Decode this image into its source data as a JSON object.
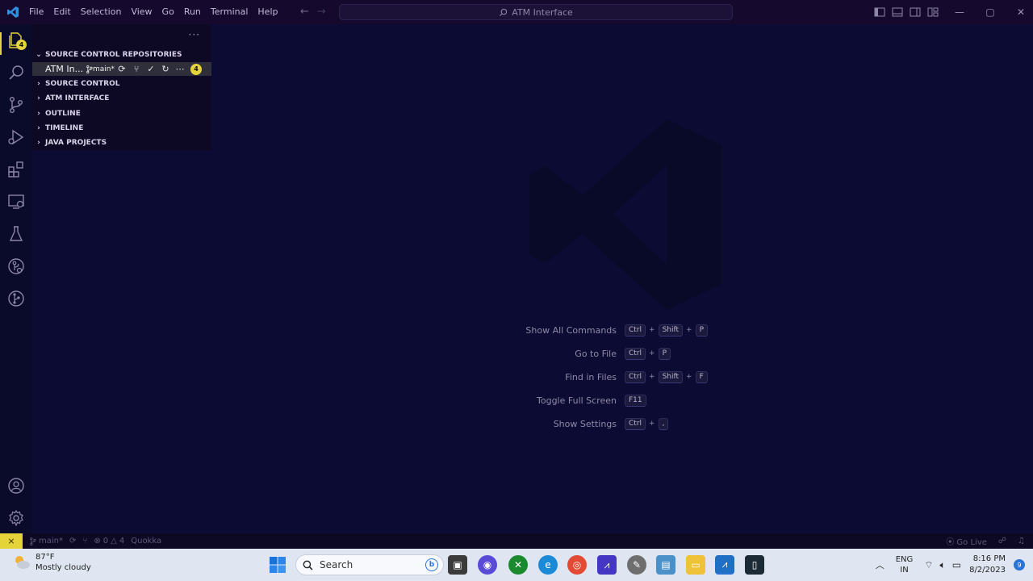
{
  "titlebar": {
    "menu": [
      "File",
      "Edit",
      "Selection",
      "View",
      "Go",
      "Run",
      "Terminal",
      "Help"
    ],
    "command_center": "ATM Interface"
  },
  "activitybar": {
    "explorer_badge": "4",
    "icons": [
      "explorer-icon",
      "search-icon",
      "source-control-icon",
      "run-debug-icon",
      "extensions-icon",
      "remote-explorer-icon",
      "testing-icon",
      "gitlens-icon",
      "git-graph-icon",
      "account-icon",
      "settings-gear-icon"
    ]
  },
  "sidebar": {
    "more": "···",
    "sections": [
      {
        "label": "SOURCE CONTROL REPOSITORIES",
        "expanded": true
      },
      {
        "label": "SOURCE CONTROL",
        "expanded": false
      },
      {
        "label": "ATM INTERFACE",
        "expanded": false
      },
      {
        "label": "OUTLINE",
        "expanded": false
      },
      {
        "label": "TIMELINE",
        "expanded": false
      },
      {
        "label": "JAVA PROJECTS",
        "expanded": false
      }
    ],
    "repo": {
      "name": "ATM In...",
      "branch": "main*",
      "badge": "4"
    }
  },
  "editor": {
    "shortcuts": [
      {
        "label": "Show All Commands",
        "keys": [
          "Ctrl",
          "Shift",
          "P"
        ]
      },
      {
        "label": "Go to File",
        "keys": [
          "Ctrl",
          "P"
        ]
      },
      {
        "label": "Find in Files",
        "keys": [
          "Ctrl",
          "Shift",
          "F"
        ]
      },
      {
        "label": "Toggle Full Screen",
        "keys": [
          "F11"
        ]
      },
      {
        "label": "Show Settings",
        "keys": [
          "Ctrl",
          ","
        ]
      }
    ]
  },
  "statusbar": {
    "branch": "main*",
    "errors": "0",
    "warnings": "4",
    "quokka": "Quokka",
    "go_live": "Go Live"
  },
  "taskbar": {
    "weather_temp": "87°F",
    "weather_desc": "Mostly cloudy",
    "search_placeholder": "Search",
    "lang_line1": "ENG",
    "lang_line2": "IN",
    "time": "8:16 PM",
    "date": "8/2/2023",
    "notification_count": "9"
  },
  "colors": {
    "accent": "#e4d43a",
    "editor_bg": "#0b0b33",
    "sidebar_bg": "#0d0824",
    "titlebar_bg": "#150a2e"
  }
}
